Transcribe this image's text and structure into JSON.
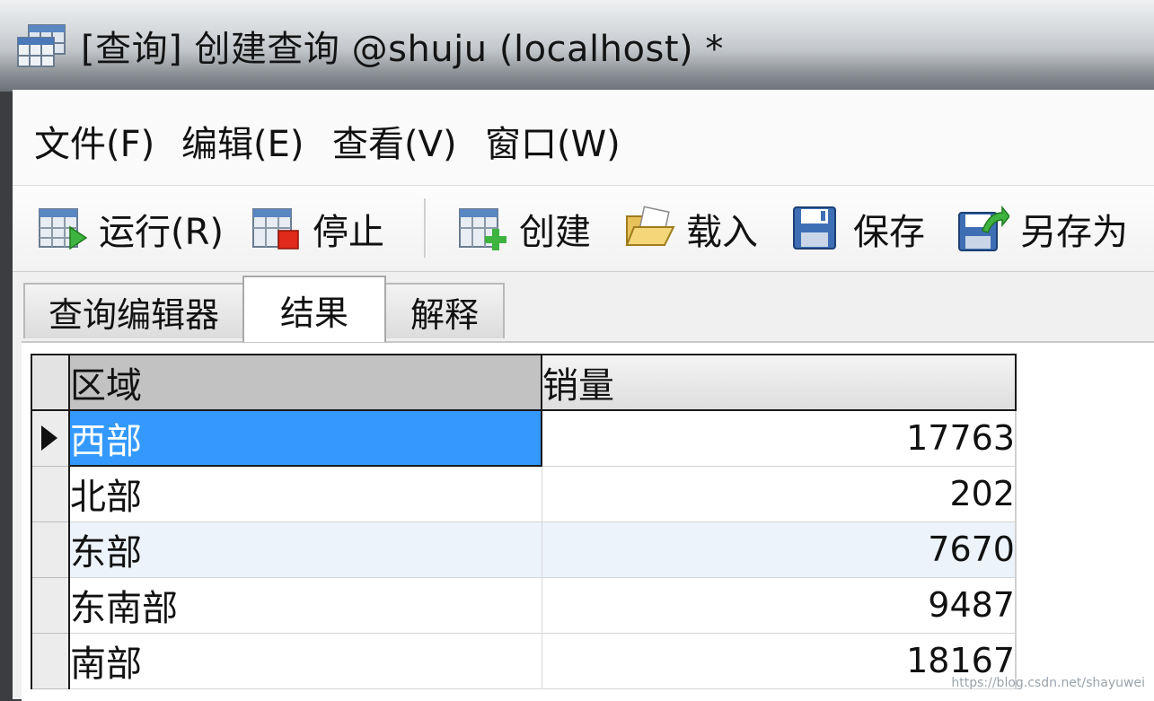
{
  "window": {
    "title": "[查询] 创建查询 @shuju (localhost) *"
  },
  "menu": [
    {
      "label": "文件(F)"
    },
    {
      "label": "编辑(E)"
    },
    {
      "label": "查看(V)"
    },
    {
      "label": "窗口(W)"
    }
  ],
  "toolbar": {
    "run": "运行(R)",
    "stop": "停止",
    "create": "创建",
    "load": "载入",
    "save": "保存",
    "save_as": "另存为"
  },
  "tabs": [
    {
      "label": "查询编辑器"
    },
    {
      "label": "结果"
    },
    {
      "label": "解释"
    }
  ],
  "active_tab": "结果",
  "grid": {
    "columns": [
      "区域",
      "销量"
    ],
    "rows": [
      [
        "西部",
        "17763"
      ],
      [
        "北部",
        "202"
      ],
      [
        "东部",
        "7670"
      ],
      [
        "东南部",
        "9487"
      ],
      [
        "南部",
        "18167"
      ]
    ],
    "selected_row": 0
  },
  "watermark": "https://blog.csdn.net/shayuwei",
  "colors": {
    "selection": "#3399ff",
    "alt_row": "#ecf3fb"
  }
}
